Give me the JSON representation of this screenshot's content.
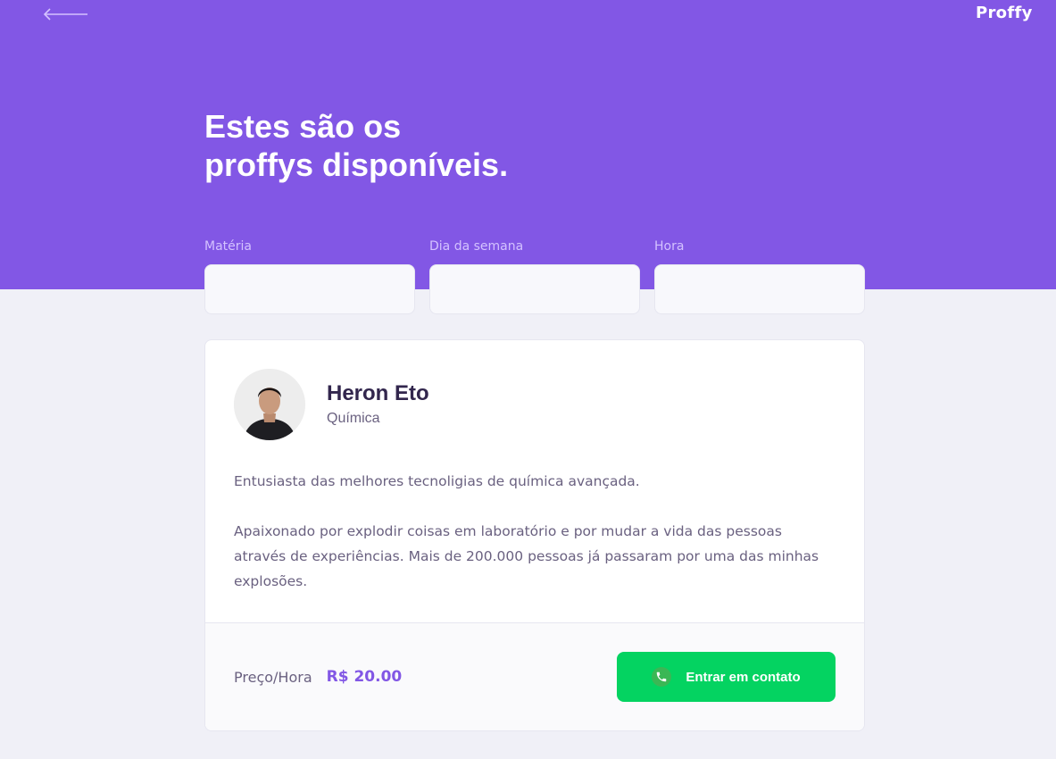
{
  "header": {
    "logo": "Proffy",
    "title_line1": "Estes são os",
    "title_line2": "proffys disponíveis.",
    "back_icon": "arrow-left-icon"
  },
  "filters": {
    "subject_label": "Matéria",
    "weekday_label": "Dia da semana",
    "time_label": "Hora",
    "subject_value": "",
    "weekday_value": "",
    "time_value": ""
  },
  "teacher": {
    "name": "Heron Eto",
    "subject": "Química",
    "bio_p1": "Entusiasta das melhores tecnoligias de química avançada.",
    "bio_p2": "Apaixonado por explodir coisas em laboratório e por mudar a vida das pessoas através de experiências. Mais de 200.000 pessoas já passaram por uma das minhas explosões.",
    "price_label": "Preço/Hora",
    "price_value": "R$ 20.00",
    "contact_label": "Entrar em contato",
    "contact_icon": "whatsapp-icon"
  },
  "colors": {
    "primary": "#8257E5",
    "background": "#F0F0F7",
    "secondary": "#04D361",
    "title_text": "#32264D",
    "body_text": "#6A6180"
  }
}
